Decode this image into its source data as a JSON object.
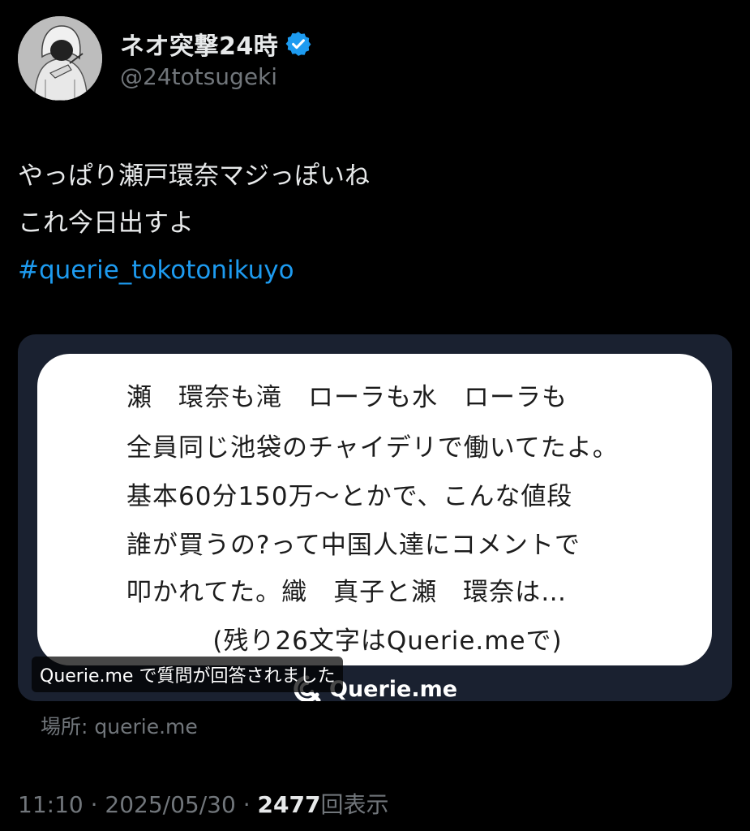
{
  "author": {
    "display_name": "ネオ突撃24時",
    "handle": "@24totsugeki",
    "verified": true
  },
  "tweet": {
    "lines": [
      "やっぱり瀬戸環奈マジっぽいね",
      "これ今日出すよ"
    ],
    "hashtag": "#querie_tokotonikuyo"
  },
  "card": {
    "answer_lines": [
      "瀬　環奈も滝　ローラも水　ローラも",
      "全員同じ池袋のチャイデリで働いてたよ。",
      "基本60分150万〜とかで、こんな値段",
      "誰が買うの?って中国人達にコメントで",
      "叩かれてた。織　真子と瀬　環奈は…",
      "(残り26文字はQuerie.meで)"
    ],
    "brand": "Querie.me",
    "caption": "Querie.me で質問が回答されました"
  },
  "location": "場所: querie.me",
  "meta": {
    "time": "11:10",
    "date": "2025/05/30",
    "views": "2477",
    "views_suffix": "回表示",
    "separator": "·"
  },
  "colors": {
    "background": "#000000",
    "hashtag": "#1d9bf0",
    "secondary_text": "#71767b",
    "verified_badge": "#1d9bf0",
    "card_background": "#1a2130"
  }
}
